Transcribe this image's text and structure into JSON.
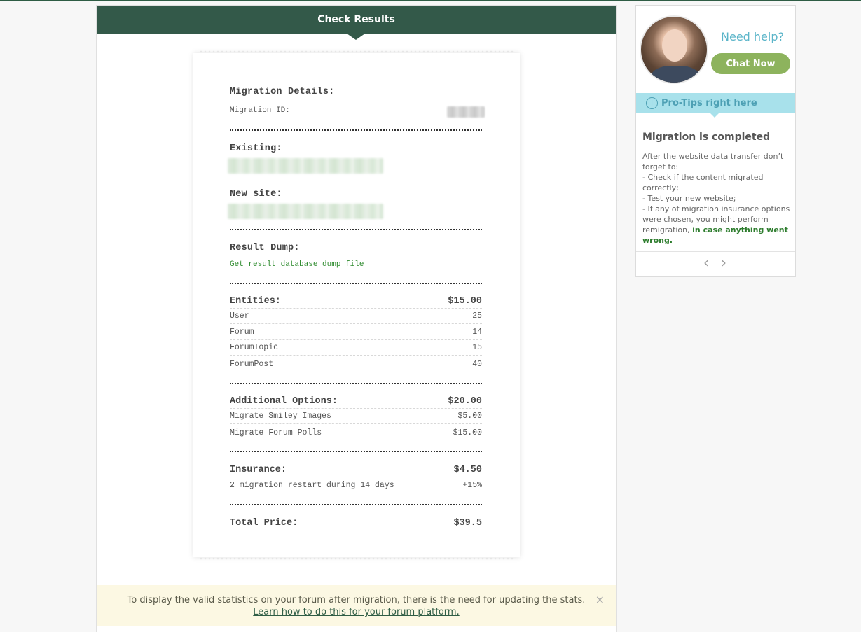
{
  "header": {
    "title": "Check Results"
  },
  "receipt": {
    "migration_details_title": "Migration Details:",
    "migration_id_label": "Migration ID:",
    "existing_label": "Existing:",
    "new_site_label": "New site:",
    "result_dump_label": "Result Dump:",
    "result_dump_link": "Get result database dump file",
    "entities": {
      "label": "Entities:",
      "total": "$15.00",
      "rows": [
        {
          "name": "User",
          "value": "25"
        },
        {
          "name": "Forum",
          "value": "14"
        },
        {
          "name": "ForumTopic",
          "value": "15"
        },
        {
          "name": "ForumPost",
          "value": "40"
        }
      ]
    },
    "additional": {
      "label": "Additional Options:",
      "total": "$20.00",
      "rows": [
        {
          "name": "Migrate Smiley Images",
          "value": "$5.00"
        },
        {
          "name": "Migrate Forum Polls",
          "value": "$15.00"
        }
      ]
    },
    "insurance": {
      "label": "Insurance:",
      "total": "$4.50",
      "rows": [
        {
          "name": "2 migration restart during 14 days",
          "value": "+15%"
        }
      ]
    },
    "total": {
      "label": "Total Price:",
      "value": "$39.5"
    }
  },
  "notice": {
    "text": "To display the valid statistics on your forum after migration, there is the need for updating the stats.",
    "link": "Learn how to do this for your forum platform.",
    "close": "×"
  },
  "sidebar": {
    "need_help": "Need help?",
    "chat_button": "Chat Now",
    "tips_label": "Pro-Tips right here",
    "tips_icon_glyph": "i",
    "tip_title": "Migration is completed",
    "tip_intro": "After the website data transfer don’t forget to:",
    "tip_line1": "- Check if the content migrated correctly;",
    "tip_line2": "- Test your new website;",
    "tip_line3": "- If any of migration insurance options were chosen, you might perform remigration,",
    "tip_green": "in case anything went wrong.",
    "prev_glyph": "‹",
    "next_glyph": "›"
  },
  "colors": {
    "header_bg": "#335949",
    "chat_button": "#8db35d",
    "tips_bar": "#a8e1eb",
    "link_green": "#2e8b2e",
    "notice_bg": "#fcf8e3"
  }
}
